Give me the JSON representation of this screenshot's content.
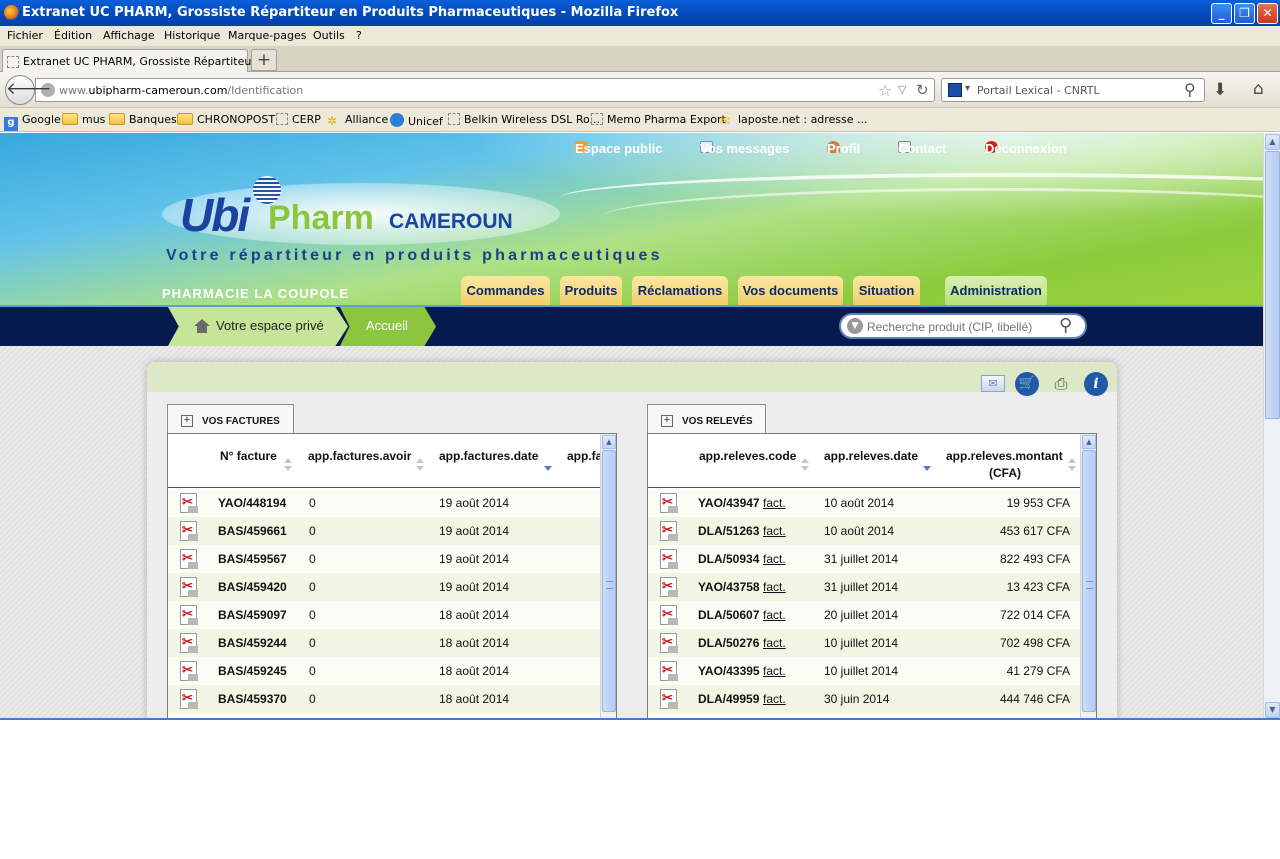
{
  "window": {
    "title": "Extranet UC PHARM, Grossiste Répartiteur en Produits Pharmaceutiques - Mozilla Firefox",
    "buttons": [
      "minimize",
      "restore",
      "close"
    ]
  },
  "menubar": [
    "Fichier",
    "Édition",
    "Affichage",
    "Historique",
    "Marque-pages",
    "Outils",
    "?"
  ],
  "tabs": {
    "active_label": "Extranet UC PHARM, Grossiste Répartiteur ...",
    "new_tab_symbol": "+"
  },
  "navbar": {
    "url_prefix": "www.",
    "url_domain": "ubipharm-cameroun.com",
    "url_path": "/Identification",
    "search_engine_text": "Portail Lexical - CNRTL"
  },
  "bookmarks": [
    {
      "label": "Google",
      "icon": "google-icon"
    },
    {
      "label": "mus",
      "icon": "folder-icon"
    },
    {
      "label": "Banques",
      "icon": "folder-icon"
    },
    {
      "label": "CHRONOPOST",
      "icon": "folder-icon"
    },
    {
      "label": "CERP",
      "icon": "page-icon"
    },
    {
      "label": "Alliance",
      "icon": "alliance-icon"
    },
    {
      "label": "Unicef",
      "icon": "globe-icon"
    },
    {
      "label": "Belkin Wireless DSL Ro...",
      "icon": "page-icon"
    },
    {
      "label": "Memo Pharma Export",
      "icon": "page-icon"
    },
    {
      "label": "laposte.net : adresse ...",
      "icon": "laposte-icon"
    }
  ],
  "site": {
    "top_links": {
      "public": "Espace public",
      "messages": "Vos messages",
      "profile": "Profil",
      "contact": "Contact",
      "logout": "Déconnexion"
    },
    "logo": {
      "ubi": "Ubi",
      "pharm": "Pharm",
      "country": "CAMEROUN"
    },
    "tagline": "Votre répartiteur en produits pharmaceutiques",
    "pharmacy_name": "PHARMACIE LA COUPOLE",
    "menu_tabs": [
      "Commandes",
      "Produits",
      "Réclamations",
      "Vos documents",
      "Situation",
      "Administration"
    ],
    "breadcrumb": {
      "home": "Votre espace privé",
      "current": "Accueil"
    },
    "product_search_placeholder": "Recherche produit (CIP, libellé)",
    "colors": {
      "accent_green": "#8cc63f",
      "navy": "#071a4e",
      "logo_blue": "#1b43a0",
      "tab_yellow": "#f1cf69"
    }
  },
  "factures": {
    "tab_label": "VOS FACTURES",
    "columns": [
      "N° facture",
      "app.factures.avoir",
      "app.factures.date",
      "app.fa"
    ],
    "rows": [
      {
        "num": "YAO/448194",
        "avoir": "0",
        "date": "19 août 2014"
      },
      {
        "num": "BAS/459661",
        "avoir": "0",
        "date": "19 août 2014"
      },
      {
        "num": "BAS/459567",
        "avoir": "0",
        "date": "19 août 2014"
      },
      {
        "num": "BAS/459420",
        "avoir": "0",
        "date": "19 août 2014"
      },
      {
        "num": "BAS/459097",
        "avoir": "0",
        "date": "18 août 2014"
      },
      {
        "num": "BAS/459244",
        "avoir": "0",
        "date": "18 août 2014"
      },
      {
        "num": "BAS/459245",
        "avoir": "0",
        "date": "18 août 2014"
      },
      {
        "num": "BAS/459370",
        "avoir": "0",
        "date": "18 août 2014"
      }
    ]
  },
  "releves": {
    "tab_label": "VOS RELEVÉS",
    "columns": [
      "app.releves.code",
      "app.releves.date",
      "app.releves.montant",
      "(CFA)"
    ],
    "link_label": "fact.",
    "rows": [
      {
        "code": "YAO/43947",
        "date": "10 août 2014",
        "montant": "19 953 CFA"
      },
      {
        "code": "DLA/51263",
        "date": "10 août 2014",
        "montant": "453 617 CFA"
      },
      {
        "code": "DLA/50934",
        "date": "31 juillet 2014",
        "montant": "822 493 CFA"
      },
      {
        "code": "YAO/43758",
        "date": "31 juillet 2014",
        "montant": "13 423 CFA"
      },
      {
        "code": "DLA/50607",
        "date": "20 juillet 2014",
        "montant": "722 014 CFA"
      },
      {
        "code": "DLA/50276",
        "date": "10 juillet 2014",
        "montant": "702 498 CFA"
      },
      {
        "code": "YAO/43395",
        "date": "10 juillet 2014",
        "montant": "41 279 CFA"
      },
      {
        "code": "DLA/49959",
        "date": "30 juin 2014",
        "montant": "444 746 CFA"
      }
    ]
  }
}
